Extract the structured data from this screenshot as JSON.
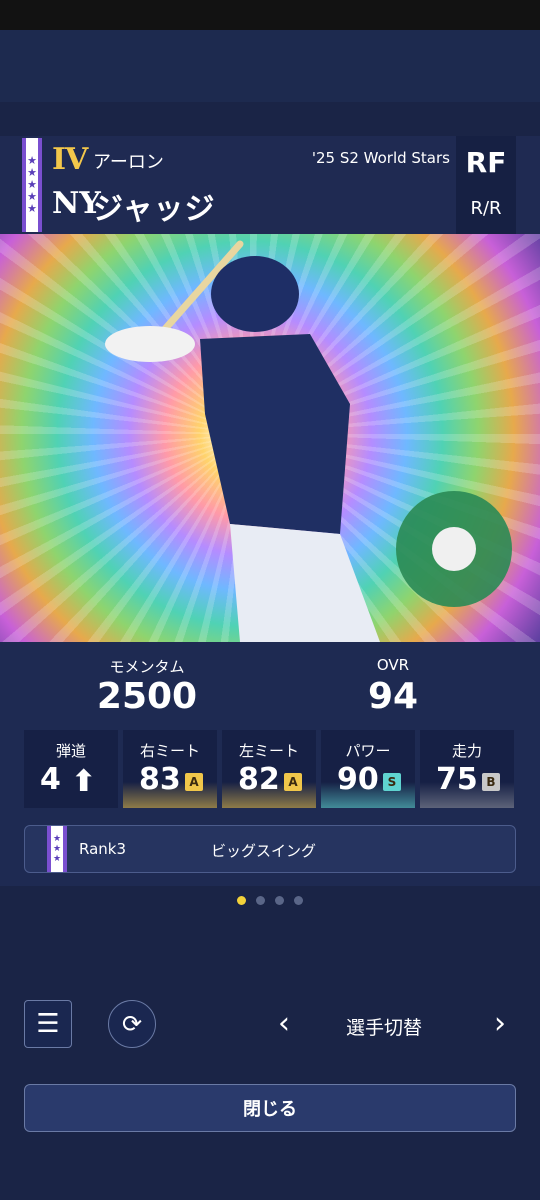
{
  "header": {
    "grade": "IV",
    "first_name": "アーロン",
    "last_name": "ジャッジ",
    "team_logo": "NY",
    "series": "'25 S2 World Stars",
    "position": "RF",
    "handedness": "R/R",
    "star_icon": "★"
  },
  "stats": {
    "momentum_label": "モメンタム",
    "momentum_value": "2500",
    "ovr_label": "OVR",
    "ovr_value": "94",
    "abilities": [
      {
        "label": "弾道",
        "value": "4",
        "icon": "arrow-up-icon"
      },
      {
        "label": "右ミート",
        "value": "83",
        "rank": "A",
        "rank_color": "#f0c64a"
      },
      {
        "label": "左ミート",
        "value": "82",
        "rank": "A",
        "rank_color": "#f0c64a"
      },
      {
        "label": "パワー",
        "value": "90",
        "rank": "S",
        "rank_color": "#5fd3d0"
      },
      {
        "label": "走力",
        "value": "75",
        "rank": "B",
        "rank_color": "#c8c8c8"
      }
    ]
  },
  "skill": {
    "rank": "Rank3",
    "name": "ビッグスイング"
  },
  "pager": {
    "count": 4,
    "active_index": 0
  },
  "controls": {
    "switch_label": "選手切替",
    "prev_symbol": "‹",
    "next_symbol": "›",
    "menu_symbol": "☰",
    "refresh_symbol": "⟳",
    "close_label": "閉じる"
  },
  "colors": {
    "accent_gold": "#f3c74b",
    "background": "#1a2446",
    "panel": "#1e2a50"
  }
}
